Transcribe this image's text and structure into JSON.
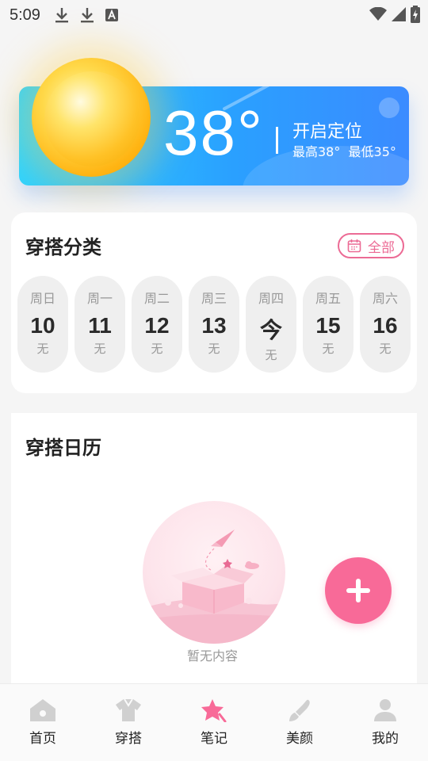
{
  "status": {
    "time": "5:09"
  },
  "weather": {
    "temperature": "38°",
    "location_action": "开启定位",
    "high": "最高38°",
    "low": "最低35°"
  },
  "category": {
    "title": "穿搭分类",
    "all_label": "全部",
    "days": [
      {
        "weekday": "周日",
        "date": "10",
        "status": "无"
      },
      {
        "weekday": "周一",
        "date": "11",
        "status": "无"
      },
      {
        "weekday": "周二",
        "date": "12",
        "status": "无"
      },
      {
        "weekday": "周三",
        "date": "13",
        "status": "无"
      },
      {
        "weekday": "周四",
        "date": "今",
        "status": "无"
      },
      {
        "weekday": "周五",
        "date": "15",
        "status": "无"
      },
      {
        "weekday": "周六",
        "date": "16",
        "status": "无"
      }
    ]
  },
  "calendar": {
    "title": "穿搭日历",
    "empty_text": "暂无内容"
  },
  "nav": {
    "items": [
      {
        "label": "首页",
        "icon": "home-icon",
        "active": false
      },
      {
        "label": "穿搭",
        "icon": "shirt-icon",
        "active": false
      },
      {
        "label": "笔记",
        "icon": "star-icon",
        "active": true
      },
      {
        "label": "美颜",
        "icon": "brush-icon",
        "active": false
      },
      {
        "label": "我的",
        "icon": "user-icon",
        "active": false
      }
    ]
  },
  "colors": {
    "accent": "#f86a98",
    "sky": "#2aa0ff",
    "nav_inactive": "#d0d0d0"
  }
}
